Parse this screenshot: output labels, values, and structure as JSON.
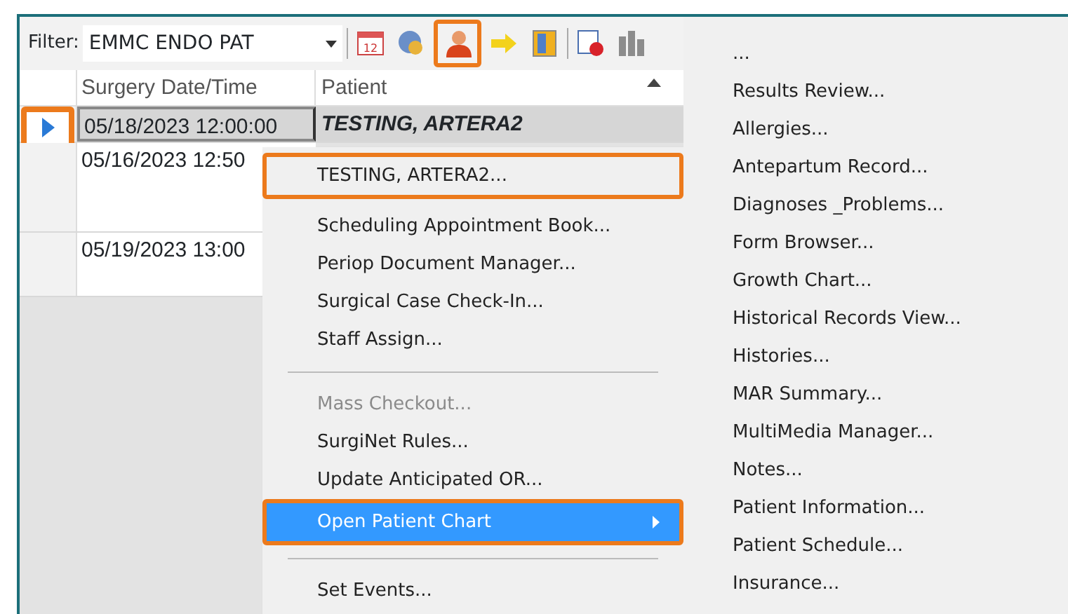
{
  "toolbar": {
    "filter_label": "Filter:",
    "filter_value": "EMMC ENDO PAT",
    "icons": [
      {
        "kind": "calendar",
        "label": "12",
        "highlighted": false,
        "disabled": false
      },
      {
        "kind": "clock",
        "highlighted": false,
        "disabled": false
      },
      {
        "kind": "person",
        "highlighted": true,
        "disabled": false
      },
      {
        "kind": "arrow",
        "highlighted": false,
        "disabled": false
      },
      {
        "kind": "door",
        "highlighted": false,
        "disabled": false
      },
      {
        "kind": "separator"
      },
      {
        "kind": "checklist",
        "highlighted": false,
        "disabled": false
      },
      {
        "kind": "columns",
        "highlighted": false,
        "disabled": true
      }
    ]
  },
  "table": {
    "columns": [
      "Surgery Date/Time",
      "Patient"
    ],
    "rows": [
      {
        "selected": true,
        "indicator_highlighted": true,
        "cells": [
          "05/18/2023 12:00:00",
          "TESTING, ARTERA2"
        ]
      },
      {
        "selected": false,
        "indicator_highlighted": false,
        "cells": [
          "05/16/2023 12:50",
          ""
        ]
      },
      {
        "selected": false,
        "indicator_highlighted": false,
        "cells": [
          "05/19/2023 13:00",
          ""
        ]
      }
    ]
  },
  "context_menu": [
    {
      "kind": "item",
      "label": "TESTING, ARTERA2...",
      "highlighted": true,
      "selected": false,
      "disabled": false
    },
    {
      "kind": "item",
      "label": "Scheduling Appointment Book...",
      "highlighted": false,
      "selected": false,
      "disabled": false
    },
    {
      "kind": "item",
      "label": "Periop Document Manager...",
      "highlighted": false,
      "selected": false,
      "disabled": false
    },
    {
      "kind": "item",
      "label": "Surgical Case Check-In...",
      "highlighted": false,
      "selected": false,
      "disabled": false
    },
    {
      "kind": "item",
      "label": "Staff Assign...",
      "highlighted": false,
      "selected": false,
      "disabled": false
    },
    {
      "kind": "separator"
    },
    {
      "kind": "item",
      "label": "Mass Checkout...",
      "highlighted": false,
      "selected": false,
      "disabled": true
    },
    {
      "kind": "item",
      "label": "SurgiNet Rules...",
      "highlighted": false,
      "selected": false,
      "disabled": false
    },
    {
      "kind": "item",
      "label": "Update Anticipated OR...",
      "highlighted": false,
      "selected": false,
      "disabled": false
    },
    {
      "kind": "submenu",
      "label": "Open Patient Chart",
      "highlighted": true,
      "selected": true,
      "disabled": false
    },
    {
      "kind": "separator"
    },
    {
      "kind": "item",
      "label": "Set Events...",
      "highlighted": false,
      "selected": false,
      "disabled": false
    }
  ],
  "submenu": [
    "...",
    "Results Review...",
    "Allergies...",
    "Antepartum Record...",
    "Diagnoses _Problems...",
    "Form Browser...",
    "Growth Chart...",
    "Historical Records View...",
    "Histories...",
    "MAR Summary...",
    "MultiMedia Manager...",
    "Notes...",
    "Patient Information...",
    "Patient Schedule...",
    "Insurance..."
  ]
}
